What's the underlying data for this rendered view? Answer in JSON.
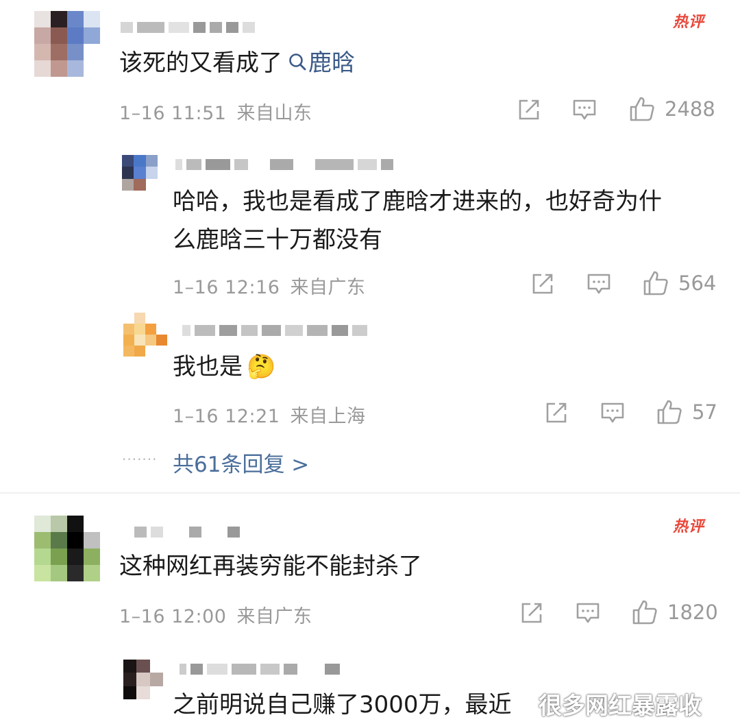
{
  "hot_label": "热评",
  "comments": [
    {
      "text": "该死的又看成了",
      "search_link": "鹿晗",
      "time": "1–16 11:51",
      "location": "来自山东",
      "likes": "2488"
    },
    {
      "text": "这种网红再装穷能不能封杀了",
      "time": "1–16 12:00",
      "location": "来自广东",
      "likes": "1820"
    }
  ],
  "replies": [
    {
      "text_line1": "哈哈，我也是看成了鹿晗才进来的，也好奇为什",
      "text_line2": "么鹿晗三十万都没有",
      "time": "1–16 12:16",
      "location": "来自广东",
      "likes": "564"
    },
    {
      "text": "我也是",
      "emoji": "🤔",
      "time": "1–16 12:21",
      "location": "来自上海",
      "likes": "57"
    },
    {
      "text": "之前明说自己赚了3000万，最近"
    }
  ],
  "more_replies": "共61条回复 >",
  "watermark": "很多网红暴露收",
  "icons": {
    "share": "share-icon",
    "comment": "comment-icon",
    "like": "thumbs-up-icon",
    "search": "search-icon"
  },
  "colors": {
    "hot": "#e8473a",
    "link": "#3c5a88",
    "meta": "#999999"
  }
}
